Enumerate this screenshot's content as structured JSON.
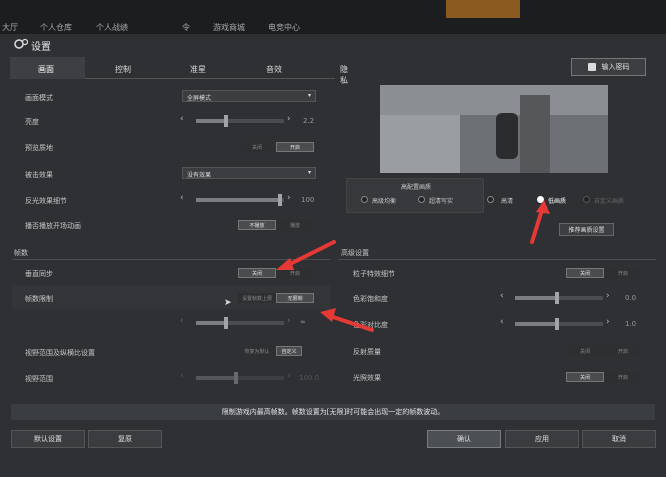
{
  "top_nav": {
    "tabs": [
      "大厅",
      "个人仓库",
      "个人战绩",
      "游戏商城",
      "电竞中心"
    ],
    "extra": "令"
  },
  "dialog": {
    "title": "设置",
    "redeem_button": "输入密码",
    "main_tabs": [
      "画面",
      "控制",
      "准星",
      "音效",
      "隐私"
    ],
    "active_tab": "画面"
  },
  "display": {
    "rows": [
      {
        "label": "画面模式",
        "control": "dropdown",
        "value": "全屏模式"
      },
      {
        "label": "亮度",
        "control": "slider",
        "value": "2.2"
      },
      {
        "label": "预览质地",
        "control": "toggle",
        "off_label": "关闭",
        "on_label": "开启"
      },
      {
        "label": "被击效果",
        "control": "dropdown",
        "value": "没有效果"
      },
      {
        "label": "反光效果细节",
        "control": "slider",
        "value": "100"
      },
      {
        "label": "播否播放开场动画",
        "control": "toggle",
        "off_label": "不播放",
        "on_label": "播放"
      }
    ]
  },
  "fps": {
    "header": "帧数",
    "rows": [
      {
        "label": "垂直同步",
        "off_label": "关闭",
        "on_label": "开启"
      },
      {
        "label": "帧数限制",
        "off_label": "设置帧数上限",
        "on_label": "无限制"
      },
      {
        "label": "视野范围及纵横比设置",
        "off_label": "恢复为默认",
        "on_label": "自定义"
      },
      {
        "label": "视野范围",
        "value": "100.0"
      }
    ],
    "fps_limit_value": "∞"
  },
  "quality": {
    "card_title": "高配置画质",
    "options": [
      {
        "label": "高级均衡",
        "selected": false
      },
      {
        "label": "超清写实",
        "selected": false
      },
      {
        "label": "高清",
        "selected": false
      },
      {
        "label": "低画质",
        "selected": true
      },
      {
        "label": "自定义画质",
        "selected": false
      }
    ],
    "recommend_button": "推荐画质设置"
  },
  "advanced": {
    "header": "高级设置",
    "rows": [
      {
        "label": "粒子特效细节",
        "control": "toggle",
        "off_label": "关闭",
        "on_label": "开启"
      },
      {
        "label": "色彩饱和度",
        "control": "slider",
        "value": "0.0"
      },
      {
        "label": "色彩对比度",
        "control": "slider",
        "value": "1.0"
      },
      {
        "label": "反射质量",
        "control": "toggle",
        "off_label": "关闭",
        "on_label": "开启"
      },
      {
        "label": "光照效果",
        "control": "toggle",
        "off_label": "关闭",
        "on_label": "开启"
      }
    ]
  },
  "banner": {
    "text": "限制游戏内最高帧数。帧数设置为[无限]时可能会出现一定的帧数波动。"
  },
  "footer": {
    "default_button": "默认设置",
    "restore_button": "复原",
    "confirm_button": "确认",
    "apply_button": "应用",
    "cancel_button": "取消"
  },
  "colors": {
    "panel": "#2e3033",
    "accent_arrow": "#e53935",
    "active_btn": "#4a4c4f"
  }
}
